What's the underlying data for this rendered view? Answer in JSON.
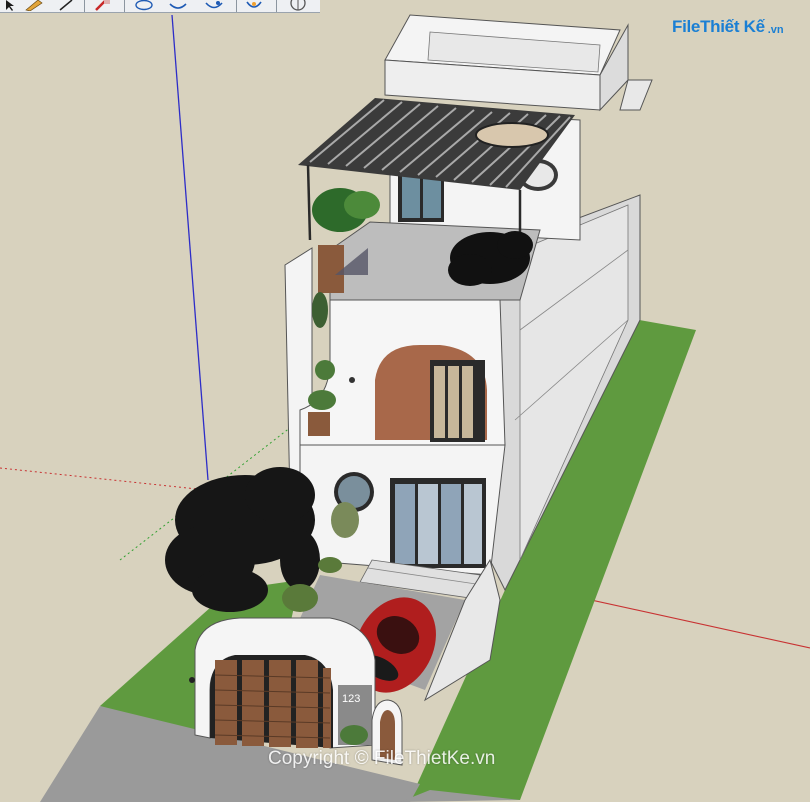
{
  "app": {
    "name": "SketchUp"
  },
  "toolbar": {
    "icons": [
      "select-icon",
      "pencil-icon",
      "line-icon",
      "eraser-icon",
      "orbit-icon",
      "pan-icon",
      "zoom-icon",
      "section-icon",
      "globe-icon"
    ]
  },
  "watermark": {
    "logo_word": "FileThiết Kế",
    "logo_suffix": ".vn",
    "copyright": "Copyright © FileThietKe.vn"
  },
  "scene": {
    "house_number": "123",
    "colors": {
      "sky": "#d8d2be",
      "grass": "#5f9a3f",
      "road": "#9a9a9a",
      "wall": "#f4f4f4",
      "wall_shade": "#d9d9d9",
      "brick": "#a8684a",
      "wood": "#8a5a3c",
      "pergola": "#3b3b3b",
      "car": "#b01e1e",
      "tree": "#1f1f1f",
      "axis_blue": "#2d2dc8",
      "axis_red": "#c83232",
      "axis_green": "#32a032"
    }
  }
}
